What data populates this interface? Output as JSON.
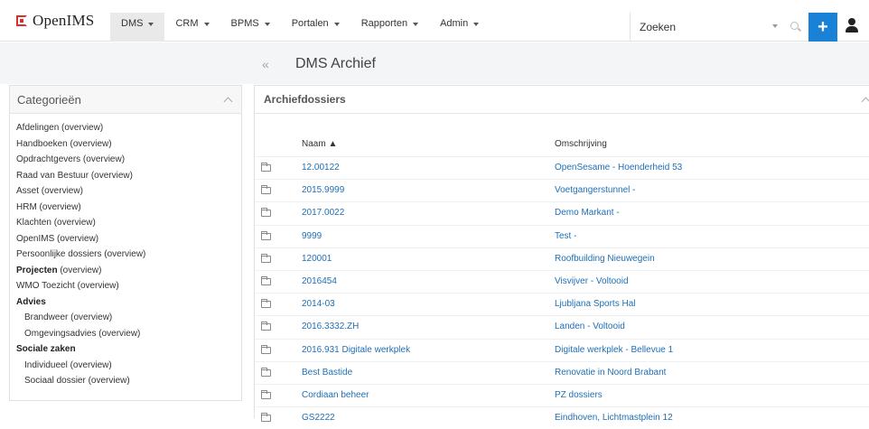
{
  "app": {
    "logo_text": "OpenIMS"
  },
  "nav": {
    "items": [
      {
        "label": "DMS"
      },
      {
        "label": "CRM"
      },
      {
        "label": "BPMS"
      },
      {
        "label": "Portalen"
      },
      {
        "label": "Rapporten"
      },
      {
        "label": "Admin"
      }
    ]
  },
  "search": {
    "value": "Zoeken"
  },
  "toolbar": {
    "add_label": "+"
  },
  "page": {
    "back_label": "«",
    "title": "DMS Archief"
  },
  "categories": {
    "title": "Categorieën",
    "items": [
      {
        "label": "Afdelingen (overview)"
      },
      {
        "label": "Handboeken (overview)"
      },
      {
        "label": "Opdrachtgevers (overview)"
      },
      {
        "label": "Raad van Bestuur (overview)"
      },
      {
        "label": "Asset (overview)"
      },
      {
        "label": "HRM (overview)"
      },
      {
        "label": "Klachten (overview)"
      },
      {
        "label": "OpenIMS (overview)"
      },
      {
        "label": "Persoonlijke dossiers (overview)"
      },
      {
        "label_bold": "Projecten",
        "label_rest": " (overview)"
      },
      {
        "label": "WMO Toezicht (overview)"
      },
      {
        "label": "Advies"
      },
      {
        "label": "Brandweer (overview)"
      },
      {
        "label": "Omgevingsadvies (overview)"
      },
      {
        "label": "Sociale zaken"
      },
      {
        "label": "Individueel (overview)"
      },
      {
        "label": "Sociaal dossier (overview)"
      }
    ]
  },
  "archive": {
    "title": "Archiefdossiers",
    "columns": {
      "name": "Naam ▲",
      "description": "Omschrijving"
    },
    "rows": [
      {
        "name": "12.00122",
        "description": "OpenSesame - Hoenderheid 53"
      },
      {
        "name": "2015.9999",
        "description": "Voetgangerstunnel -"
      },
      {
        "name": "2017.0022",
        "description": "Demo Markant -"
      },
      {
        "name": "9999",
        "description": "Test -"
      },
      {
        "name": "120001",
        "description": "Roofbuilding Nieuwegein"
      },
      {
        "name": "2016454",
        "description": "Visvijver - Voltooid"
      },
      {
        "name": "2014-03",
        "description": "Ljubljana Sports Hal"
      },
      {
        "name": "2016.3332.ZH",
        "description": "Landen - Voltooid"
      },
      {
        "name": "2016.931 Digitale werkplek",
        "description": "Digitale werkplek - Bellevue 1"
      },
      {
        "name": "Best Bastide",
        "description": "Renovatie in Noord Brabant"
      },
      {
        "name": "Cordiaan beheer",
        "description": "PZ dossiers"
      },
      {
        "name": "GS2222",
        "description": "Eindhoven, Lichtmastplein 12"
      }
    ]
  }
}
